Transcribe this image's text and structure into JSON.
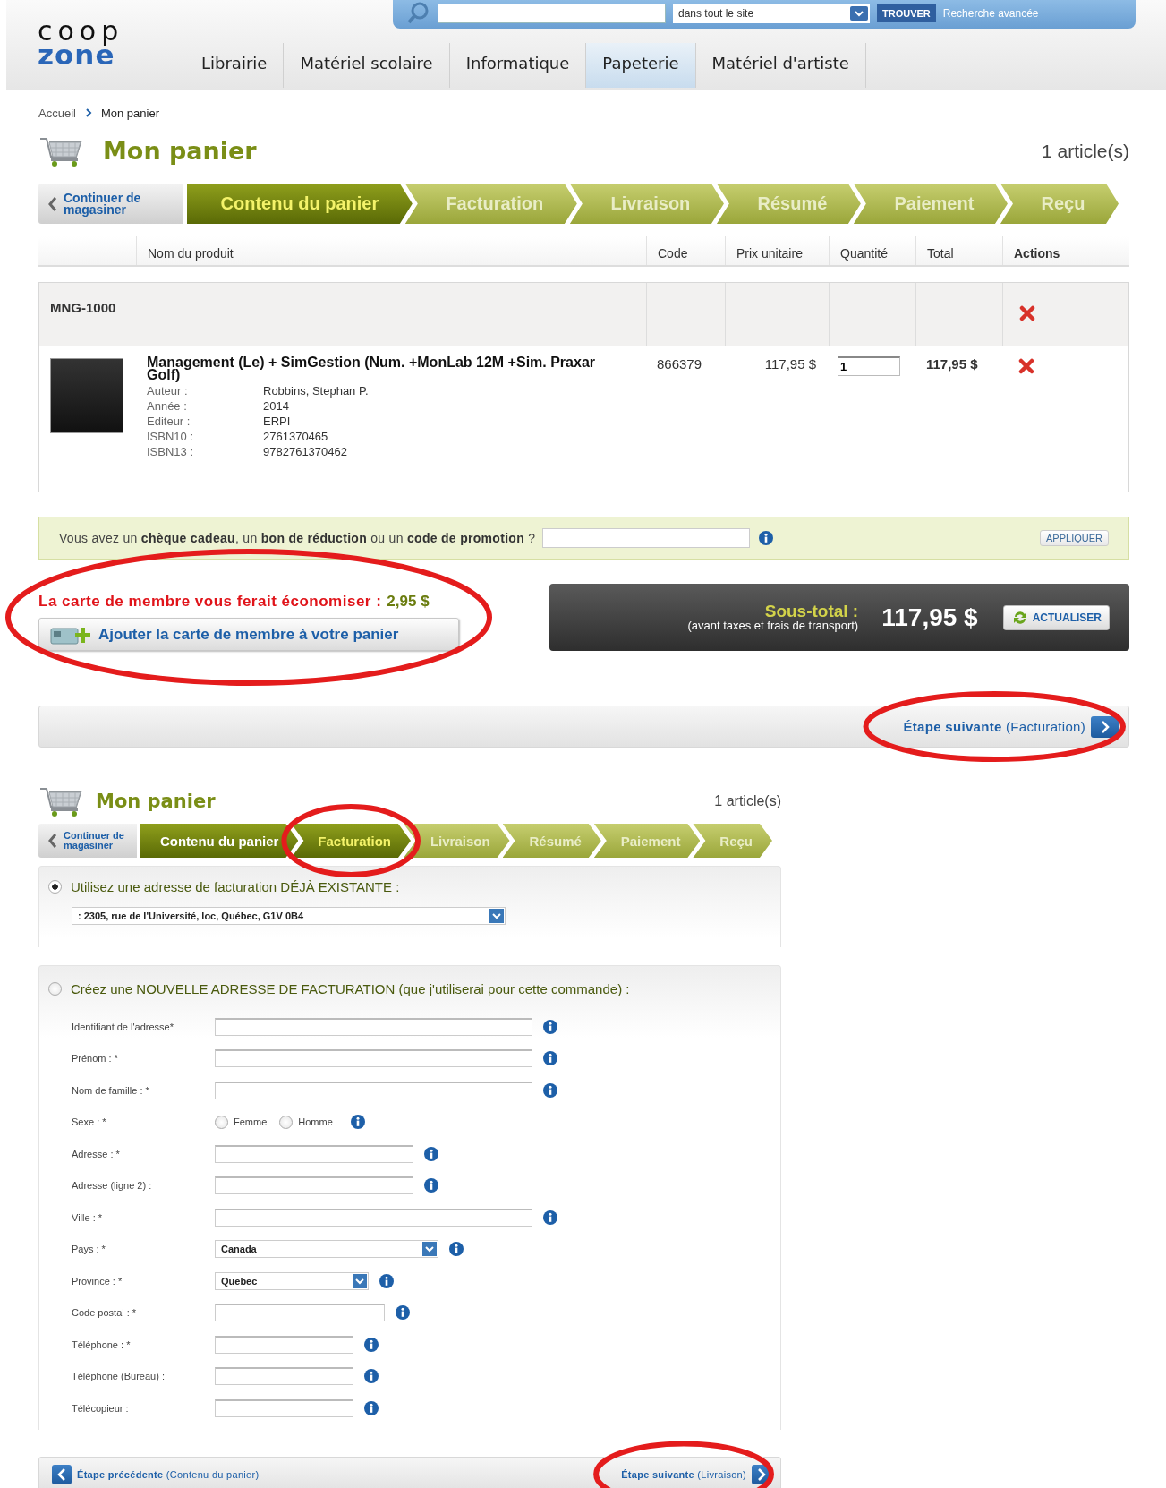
{
  "header": {
    "logo": {
      "line1": "coop",
      "line2": "zone"
    },
    "search": {
      "scope": "dans tout le site",
      "button": "TROUVER",
      "advanced": "Recherche avancée"
    },
    "nav": [
      {
        "label": "Librairie",
        "selected": false
      },
      {
        "label": "Matériel scolaire",
        "selected": false
      },
      {
        "label": "Informatique",
        "selected": false
      },
      {
        "label": "Papeterie",
        "selected": true
      },
      {
        "label": "Matériel d'artiste",
        "selected": false
      }
    ]
  },
  "breadcrumb": [
    "Accueil",
    "Mon panier"
  ],
  "cart": {
    "title": "Mon panier",
    "count": "1 article(s)",
    "back": "Continuer de magasiner",
    "steps": [
      {
        "label": "Contenu du panier",
        "selected": true,
        "completed": false
      },
      {
        "label": "Facturation",
        "selected": false,
        "completed": false
      },
      {
        "label": "Livraison",
        "selected": false,
        "completed": false
      },
      {
        "label": "Résumé",
        "selected": false,
        "completed": false
      },
      {
        "label": "Paiement",
        "selected": false,
        "completed": false
      },
      {
        "label": "Reçu",
        "selected": false,
        "completed": false
      }
    ],
    "columns": [
      "Nom du produit",
      "Code",
      "Prix unitaire",
      "Quantité",
      "Total",
      "Actions"
    ],
    "group": {
      "code": "MNG-1000"
    },
    "items": [
      {
        "title": "Management (Le) + SimGestion (Num. +MonLab 12M +Sim. Praxar Golf)",
        "details": [
          {
            "label": "Auteur :",
            "value": "Robbins, Stephan P."
          },
          {
            "label": "Année :",
            "value": "2014"
          },
          {
            "label": "Editeur :",
            "value": "ERPI"
          },
          {
            "label": "ISBN10 :",
            "value": "2761370465"
          },
          {
            "label": "ISBN13 :",
            "value": "9782761370462"
          }
        ],
        "code": "866379",
        "price": "117,95 $",
        "quantity": "1",
        "total": "117,95 $"
      }
    ]
  },
  "promo": {
    "text": "Vous avez un **chèque cadeau**, un **bon de réduction** ou un **code de promotion** ?",
    "button": "APPLIQUER"
  },
  "membership": {
    "annotated": true,
    "label": "La carte de membre vous ferait économiser :",
    "amount": "2,95 $",
    "button": "Ajouter la carte de membre à votre panier"
  },
  "subtotal": {
    "label": "Sous-total :",
    "note": "(avant taxes et frais de transport)",
    "amount": "117,95 $",
    "button": "ACTUALISER"
  },
  "next": {
    "annotated": true,
    "text": "**Étape suivante** (Facturation)"
  },
  "billing": {
    "title": "Mon panier",
    "count": "1 article(s)",
    "back": "Continuer de magasiner",
    "steps": [
      {
        "label": "Contenu du panier",
        "selected": false,
        "completed": true
      },
      {
        "label": "Facturation",
        "selected": true,
        "completed": false,
        "annotated": true
      },
      {
        "label": "Livraison",
        "selected": false,
        "completed": false
      },
      {
        "label": "Résumé",
        "selected": false,
        "completed": false
      },
      {
        "label": "Paiement",
        "selected": false,
        "completed": false
      },
      {
        "label": "Reçu",
        "selected": false,
        "completed": false
      }
    ],
    "existing": {
      "selected": true,
      "label": "Utilisez une adresse de facturation DÉJÀ EXISTANTE :",
      "address": ": 2305, rue de l'Université, loc, Québec, G1V 0B4"
    },
    "new": {
      "selected": false,
      "label": "Créez une NOUVELLE ADRESSE DE FACTURATION (que j'utiliserai pour cette commande) :",
      "fields": [
        {
          "label": "Identifiant de l'adresse*",
          "kind": "text"
        },
        {
          "label": "Prénom : *",
          "kind": "text"
        },
        {
          "label": "Nom de famille : *",
          "kind": "text"
        },
        {
          "label": "Sexe : *",
          "kind": "radio",
          "options": [
            {
              "label": "Femme",
              "selected": false
            },
            {
              "label": "Homme",
              "selected": false
            }
          ]
        },
        {
          "label": "Adresse : *",
          "kind": "text"
        },
        {
          "label": "Adresse (ligne 2) :",
          "kind": "text"
        },
        {
          "label": "Ville : *",
          "kind": "text"
        },
        {
          "label": "Pays : *",
          "kind": "select",
          "value": "Canada"
        },
        {
          "label": "Province : *",
          "kind": "select",
          "value": "Quebec"
        },
        {
          "label": "Code postal : *",
          "kind": "text"
        },
        {
          "label": "Téléphone : *",
          "kind": "text"
        },
        {
          "label": "Téléphone (Bureau) :",
          "kind": "text"
        },
        {
          "label": "Télécopieur :",
          "kind": "text"
        }
      ]
    },
    "prev": {
      "text": "**Étape précédente** (Contenu du panier)"
    },
    "next": {
      "annotated": true,
      "text": "**Étape suivante** (Livraison)"
    }
  }
}
